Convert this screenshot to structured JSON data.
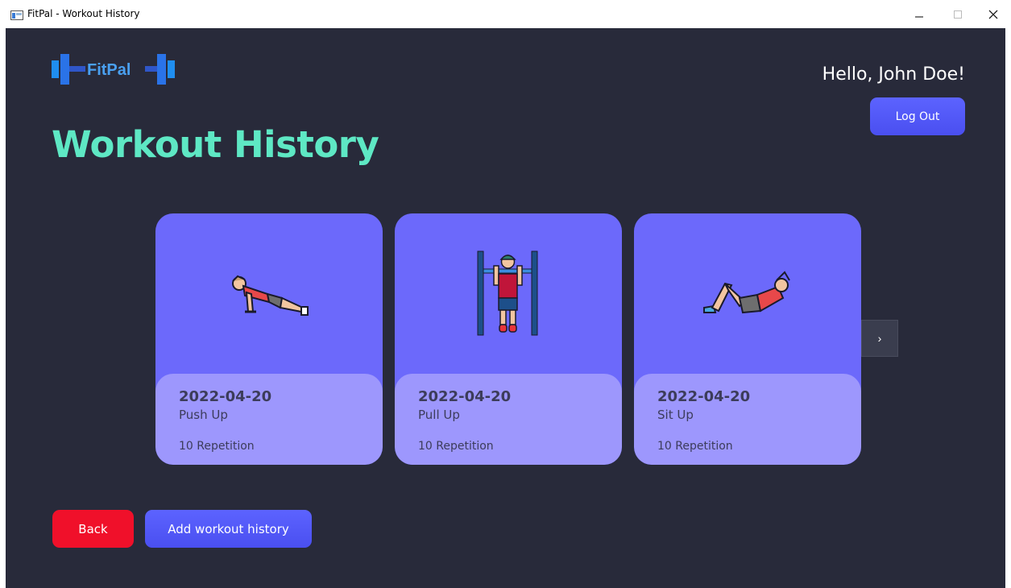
{
  "window": {
    "title": "FitPal - Workout History"
  },
  "header": {
    "logo_text": "FitPal",
    "greeting": "Hello, John Doe!",
    "logout_label": "Log Out"
  },
  "page": {
    "title": "Workout History"
  },
  "workouts": [
    {
      "date": "2022-04-20",
      "name": "Push Up",
      "reps": "10 Repetition",
      "icon": "push-up-icon"
    },
    {
      "date": "2022-04-20",
      "name": "Pull Up",
      "reps": "10 Repetition",
      "icon": "pull-up-icon"
    },
    {
      "date": "2022-04-20",
      "name": "Sit Up",
      "reps": "10 Repetition",
      "icon": "sit-up-icon"
    }
  ],
  "carousel": {
    "next_label": "›"
  },
  "footer": {
    "back_label": "Back",
    "add_label": "Add workout history"
  },
  "colors": {
    "background": "#282a3a",
    "title": "#5ee8c4",
    "card": "#6c69fb",
    "card_info": "#9d97fd",
    "primary_button": "#5058f8",
    "danger_button": "#f0102a"
  }
}
